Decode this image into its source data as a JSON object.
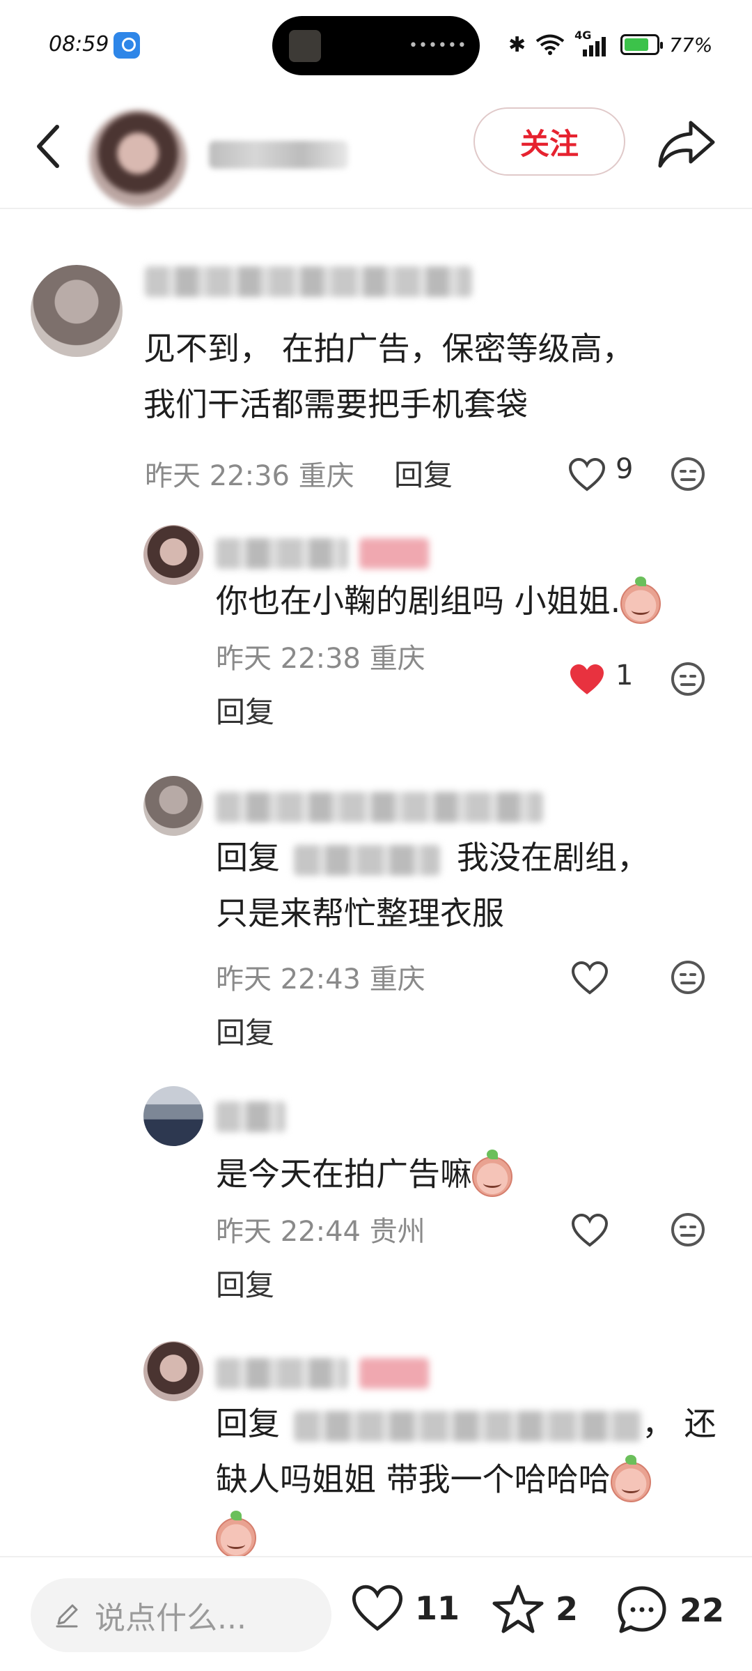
{
  "status_bar": {
    "time": "08:59",
    "network": "4G",
    "battery": "77%",
    "battery_level": 0.77
  },
  "header": {
    "follow_label": "关注"
  },
  "comments": [
    {
      "text_line1": "见不到， 在拍广告，保密等级高，",
      "text_line2": "我们干活都需要把手机套袋",
      "time": "昨天 22:36",
      "location": "重庆",
      "reply": "回复",
      "likes": "9",
      "liked": false
    },
    {
      "text": "你也在小鞠的剧组吗 小姐姐.",
      "time": "昨天 22:38",
      "location": "重庆",
      "reply": "回复",
      "likes": "1",
      "liked": true
    },
    {
      "prefix": "回复",
      "text_line1": "我没在剧组，",
      "text_line2": "只是来帮忙整理衣服",
      "time": "昨天 22:43",
      "location": "重庆",
      "reply": "回复",
      "liked": false
    },
    {
      "text": "是今天在拍广告嘛",
      "time": "昨天 22:44",
      "location": "贵州",
      "reply": "回复",
      "liked": false
    },
    {
      "prefix": "回复",
      "text_line1_end": "， 还",
      "text_line2": "缺人吗姐姐 带我一个哈哈哈"
    }
  ],
  "bottom_bar": {
    "placeholder": "说点什么...",
    "likes": "11",
    "favorites": "2",
    "comments": "22"
  },
  "colors": {
    "accent": "#e6222f",
    "liked_heart": "#e8323f"
  }
}
